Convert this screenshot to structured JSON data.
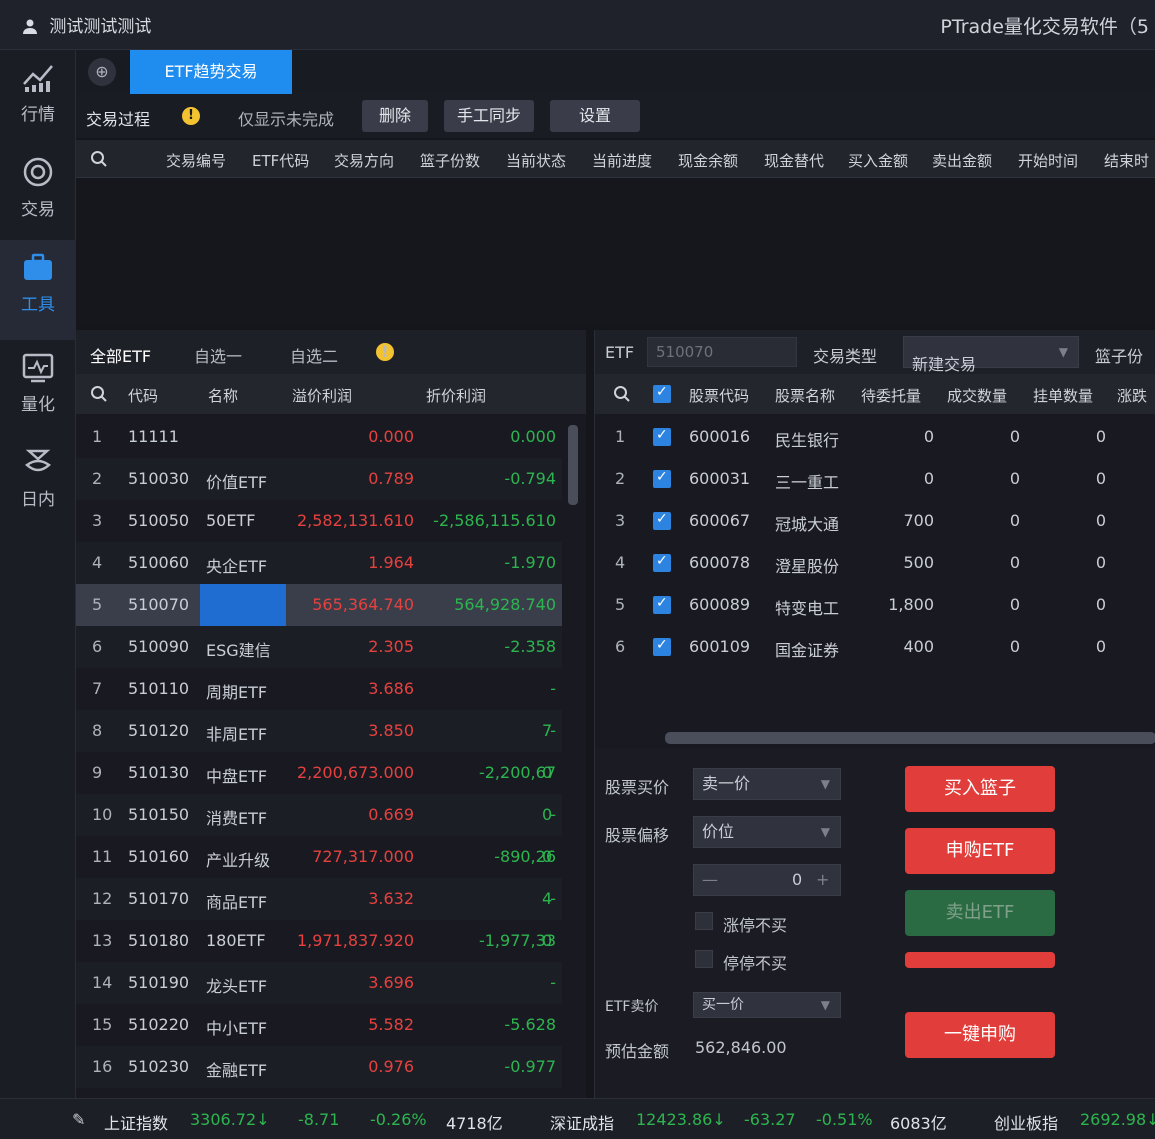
{
  "titlebar": {
    "user": "测试测试测试",
    "app_title": "PTrade量化交易软件（5"
  },
  "sidebar": {
    "items": [
      {
        "label": "行情",
        "icon": "chart-icon"
      },
      {
        "label": "交易",
        "icon": "trade-icon"
      },
      {
        "label": "工具",
        "icon": "briefcase-icon"
      },
      {
        "label": "量化",
        "icon": "quant-icon"
      },
      {
        "label": "日内",
        "icon": "intraday-icon"
      }
    ]
  },
  "tabs": {
    "active_label": "ETF趋势交易",
    "home_glyph": "⊕"
  },
  "process_toolbar": {
    "label": "交易过程",
    "warn": "!",
    "only_unfinished": "仅显示未完成",
    "delete": "删除",
    "manual_sync": "手工同步",
    "settings": "设置"
  },
  "process_table": {
    "columns": [
      "交易编号",
      "ETF代码",
      "交易方向",
      "篮子份数",
      "当前状态",
      "当前进度",
      "现金余额",
      "现金替代",
      "买入金额",
      "卖出金额",
      "开始时间",
      "结束时"
    ]
  },
  "etf_list": {
    "tabs": [
      "全部ETF",
      "自选一",
      "自选二"
    ],
    "warn": "!",
    "columns": [
      "代码",
      "名称",
      "溢价利润",
      "折价利润"
    ],
    "rows": [
      {
        "idx": "1",
        "code": "11111",
        "name": "",
        "premium": "0.000",
        "discount": "0.000",
        "extra": ""
      },
      {
        "idx": "2",
        "code": "510030",
        "name": "价值ETF",
        "premium": "0.789",
        "discount": "-0.794",
        "extra": ""
      },
      {
        "idx": "3",
        "code": "510050",
        "name": "50ETF",
        "premium": "2,582,131.610",
        "discount": "-2,586,115.610",
        "extra": ""
      },
      {
        "idx": "4",
        "code": "510060",
        "name": "央企ETF",
        "premium": "1.964",
        "discount": "-1.970",
        "extra": ""
      },
      {
        "idx": "5",
        "code": "510070",
        "name": "",
        "premium": "565,364.740",
        "discount": "564,928.740",
        "extra": ""
      },
      {
        "idx": "6",
        "code": "510090",
        "name": "ESG建信",
        "premium": "2.305",
        "discount": "-2.358",
        "extra": ""
      },
      {
        "idx": "7",
        "code": "510110",
        "name": "周期ETF",
        "premium": "3.686",
        "discount": "-",
        "extra": ""
      },
      {
        "idx": "8",
        "code": "510120",
        "name": "非周ETF",
        "premium": "3.850",
        "discount": "-",
        "extra": "7"
      },
      {
        "idx": "9",
        "code": "510130",
        "name": "中盘ETF",
        "premium": "2,200,673.000",
        "discount": "-2,200,67",
        "extra": "0"
      },
      {
        "idx": "10",
        "code": "510150",
        "name": "消费ETF",
        "premium": "0.669",
        "discount": "-",
        "extra": "0"
      },
      {
        "idx": "11",
        "code": "510160",
        "name": "产业升级",
        "premium": "727,317.000",
        "discount": "-890,26",
        "extra": "0"
      },
      {
        "idx": "12",
        "code": "510170",
        "name": "商品ETF",
        "premium": "3.632",
        "discount": "-",
        "extra": "4"
      },
      {
        "idx": "13",
        "code": "510180",
        "name": "180ETF",
        "premium": "1,971,837.920",
        "discount": "-1,977,33",
        "extra": "0"
      },
      {
        "idx": "14",
        "code": "510190",
        "name": "龙头ETF",
        "premium": "3.696",
        "discount": "-",
        "extra": ""
      },
      {
        "idx": "15",
        "code": "510220",
        "name": "中小ETF",
        "premium": "5.582",
        "discount": "-5.628",
        "extra": ""
      },
      {
        "idx": "16",
        "code": "510230",
        "name": "金融ETF",
        "premium": "0.976",
        "discount": "-0.977",
        "extra": ""
      }
    ]
  },
  "stock_panel": {
    "etf_label": "ETF",
    "etf_placeholder": "510070",
    "trade_type_label": "交易类型",
    "trade_type_value": "新建交易",
    "basket_label": "篮子份",
    "columns": [
      "股票代码",
      "股票名称",
      "待委托量",
      "成交数量",
      "挂单数量",
      "涨跌"
    ],
    "rows": [
      {
        "idx": "1",
        "code": "600016",
        "name": "民生银行",
        "pending": "0",
        "filled": "0",
        "order": "0"
      },
      {
        "idx": "2",
        "code": "600031",
        "name": "三一重工",
        "pending": "0",
        "filled": "0",
        "order": "0"
      },
      {
        "idx": "3",
        "code": "600067",
        "name": "冠城大通",
        "pending": "700",
        "filled": "0",
        "order": "0"
      },
      {
        "idx": "4",
        "code": "600078",
        "name": "澄星股份",
        "pending": "500",
        "filled": "0",
        "order": "0"
      },
      {
        "idx": "5",
        "code": "600089",
        "name": "特变电工",
        "pending": "1,800",
        "filled": "0",
        "order": "0"
      },
      {
        "idx": "6",
        "code": "600109",
        "name": "国金证券",
        "pending": "400",
        "filled": "0",
        "order": "0"
      }
    ],
    "controls": {
      "buy_price_label": "股票买价",
      "buy_price_value": "卖一价",
      "offset_label": "股票偏移",
      "offset_value": "价位",
      "stepper_value": "0",
      "limit_up_label": "涨停不买",
      "suspended_label": "停停不买",
      "etf_sell_label": "ETF卖价",
      "etf_sell_value": "买一价",
      "estimate_label": "预估金额",
      "estimate_value": "562,846.00",
      "buy_basket": "买入篮子",
      "subscribe_etf": "申购ETF",
      "sell_etf": "卖出ETF",
      "one_click": "一键申购"
    }
  },
  "status_bar": {
    "sh_name": "上证指数",
    "sh_value": "3306.72↓",
    "sh_change": "-8.71",
    "sh_pct": "-0.26%",
    "sh_amount": "4718亿",
    "sz_name": "深证成指",
    "sz_value": "12423.86↓",
    "sz_change": "-63.27",
    "sz_pct": "-0.51%",
    "sz_amount": "6083亿",
    "cy_name": "创业板指",
    "cy_value": "2692.98↓"
  },
  "colors": {
    "accent": "#1f8df0",
    "up": "#e5413f",
    "down": "#2cb54f",
    "bg": "#15161c"
  }
}
